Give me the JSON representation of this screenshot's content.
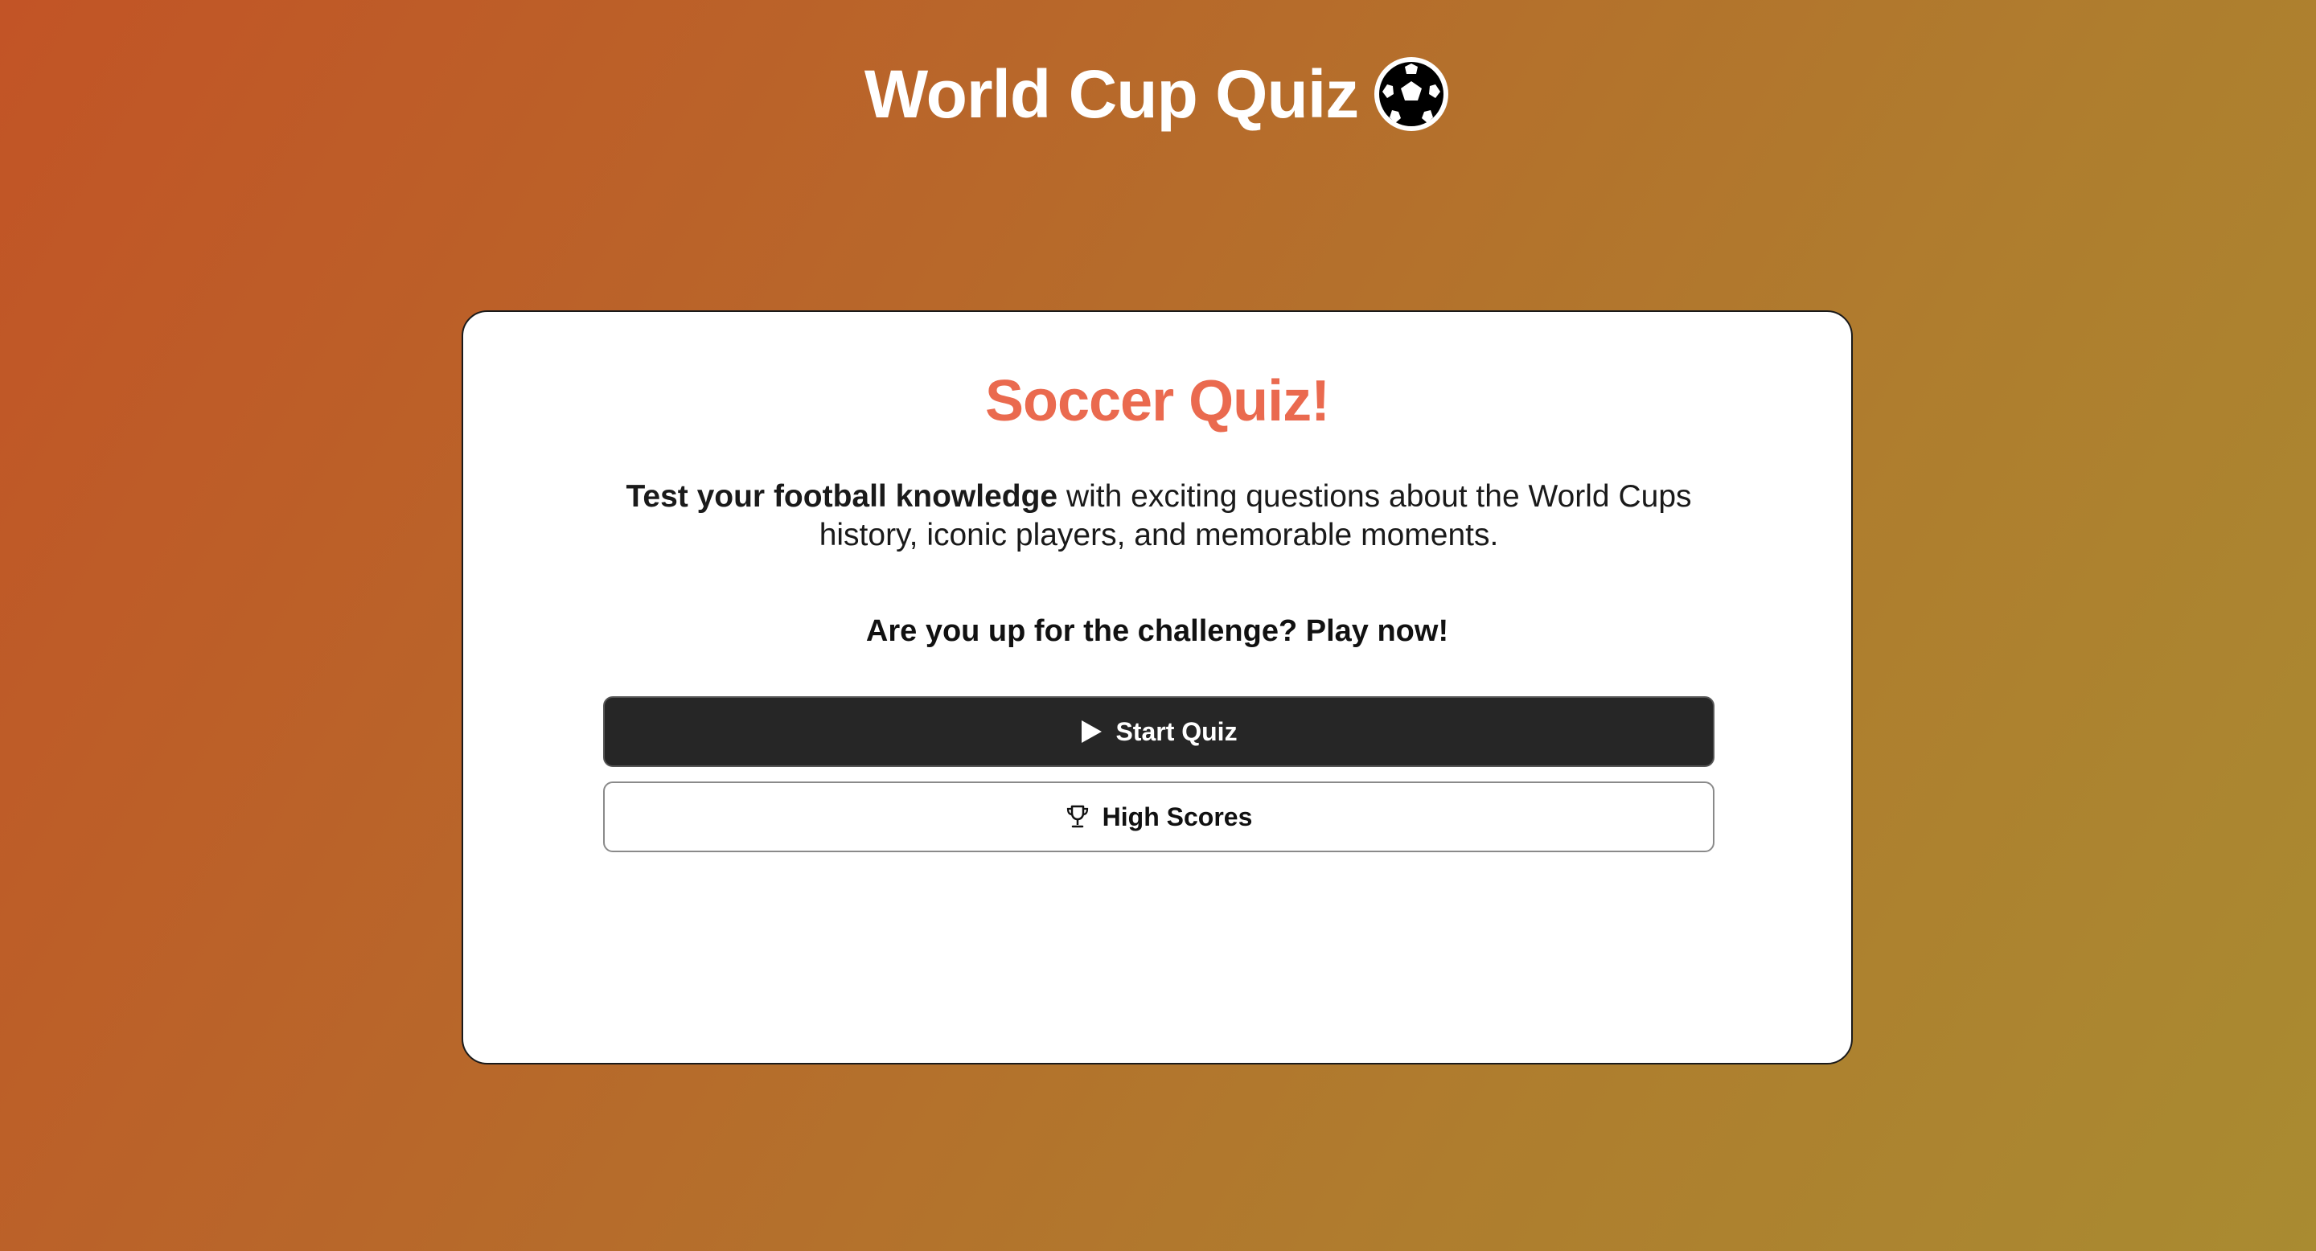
{
  "header": {
    "title": "World Cup Quiz",
    "title_icon": "soccer-ball-icon"
  },
  "card": {
    "title": "Soccer Quiz!",
    "description_bold": "Test your football knowledge",
    "description_rest": " with exciting questions about the World Cups history, iconic players, and memorable moments.",
    "challenge": "Are you up for the challenge? Play now!"
  },
  "buttons": {
    "start_label": "Start Quiz",
    "start_icon": "play-icon",
    "scores_label": "High Scores",
    "scores_icon": "trophy-icon"
  },
  "colors": {
    "card_title": "#ea6a4f",
    "primary_button": "#262626",
    "background_start": "#c25426",
    "background_end": "#a98b31"
  }
}
